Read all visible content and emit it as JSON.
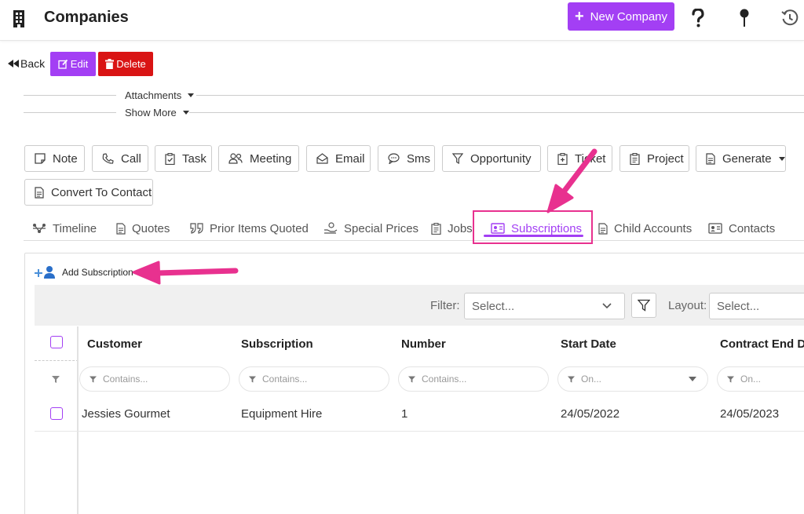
{
  "header": {
    "title": "Companies",
    "new_button": "New Company",
    "icons": [
      "building-icon",
      "help-icon",
      "pin-icon",
      "history-icon"
    ]
  },
  "toolbar": {
    "back": "Back",
    "edit": "Edit",
    "delete": "Delete"
  },
  "sections": {
    "attachments": "Attachments",
    "show_more": "Show More"
  },
  "activities": {
    "note": "Note",
    "call": "Call",
    "task": "Task",
    "meeting": "Meeting",
    "email": "Email",
    "sms": "Sms",
    "opportunity": "Opportunity",
    "ticket": "Ticket",
    "project": "Project",
    "generate": "Generate",
    "convert": "Convert To Contact"
  },
  "tabs": {
    "timeline": "Timeline",
    "quotes": "Quotes",
    "prior": "Prior Items Quoted",
    "special": "Special Prices",
    "jobs": "Jobs",
    "subscriptions": "Subscriptions",
    "child": "Child Accounts",
    "contacts": "Contacts",
    "active": "Subscriptions"
  },
  "panel": {
    "add_subscription": "Add Subscription",
    "filter_label": "Filter:",
    "filter_placeholder": "Select...",
    "layout_label": "Layout:",
    "layout_placeholder": "Select..."
  },
  "grid": {
    "columns": {
      "customer": "Customer",
      "subscription": "Subscription",
      "number": "Number",
      "start_date": "Start Date",
      "contract_end": "Contract End Dat"
    },
    "filters": {
      "customer": "Contains...",
      "subscription": "Contains...",
      "number": "Contains...",
      "start_date": "On...",
      "contract_end": "On..."
    },
    "rows": [
      {
        "customer": "Jessies Gourmet",
        "subscription": "Equipment Hire",
        "number": "1",
        "start_date": "24/05/2022",
        "contract_end": "24/05/2023"
      }
    ]
  },
  "colors": {
    "accent": "#a33ff4",
    "danger": "#d91414",
    "annotation": "#e8318f"
  }
}
